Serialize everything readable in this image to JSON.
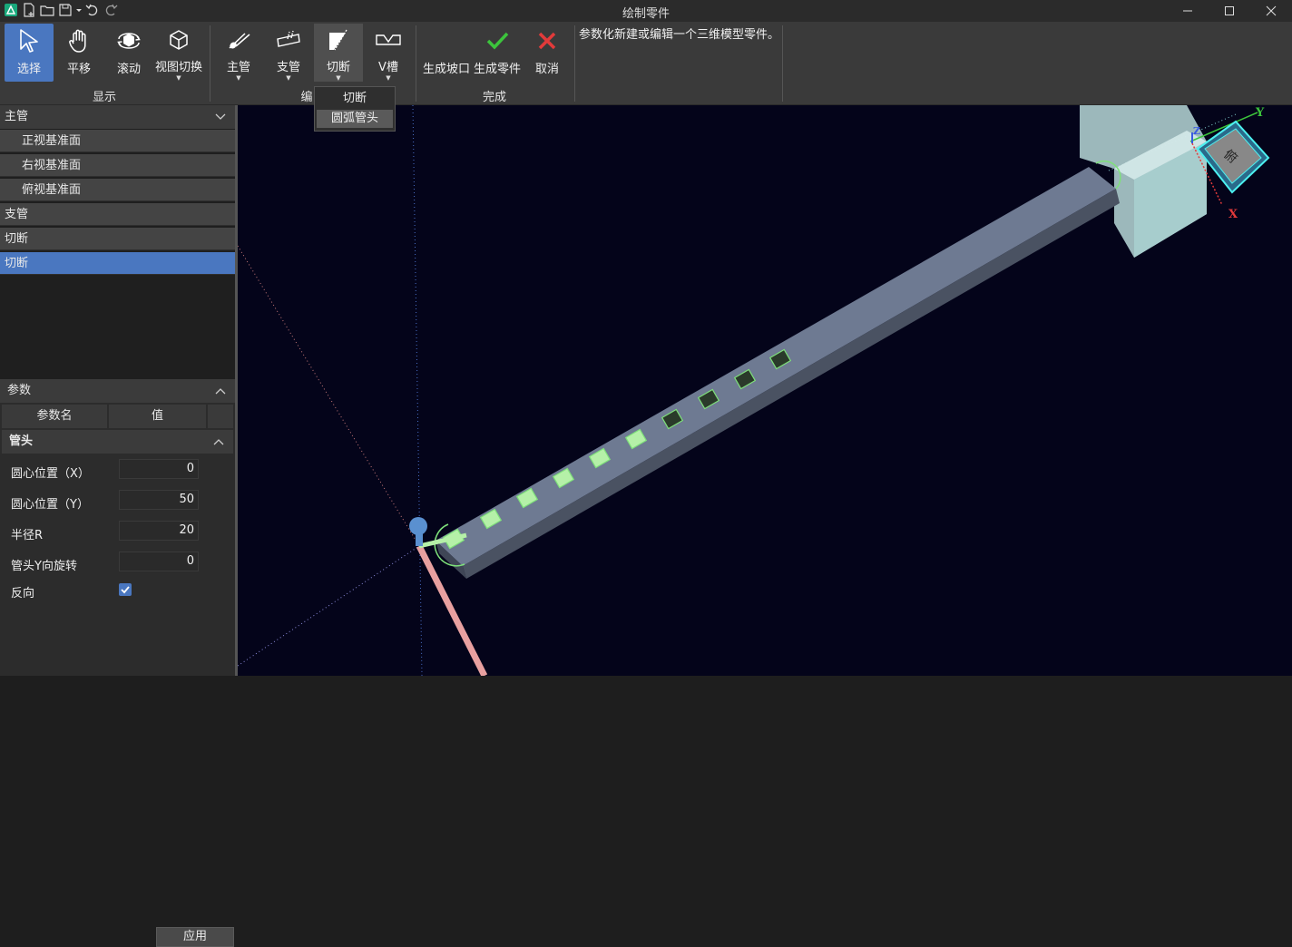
{
  "window": {
    "title": "绘制零件"
  },
  "ribbon": {
    "buttons": {
      "select": "选择",
      "pan": "平移",
      "rotate": "滚动",
      "view_switch": "视图切换",
      "main_pipe": "主管",
      "branch_pipe": "支管",
      "cut": "切断",
      "v_groove": "V槽",
      "gen_bevel": "生成坡口",
      "gen_part": "生成零件",
      "cancel": "取消"
    },
    "groups": {
      "display": "显示",
      "edit": "编",
      "finish": "完成"
    },
    "hint": "参数化新建或编辑一个三维模型零件。"
  },
  "dropdown": {
    "items": [
      "切断",
      "圆弧管头"
    ],
    "selected": "圆弧管头"
  },
  "tree": {
    "main_pipe": "主管",
    "planes": [
      "正视基准面",
      "右视基准面",
      "俯视基准面"
    ],
    "branch_pipe": "支管",
    "cut1": "切断",
    "cut2": "切断"
  },
  "params": {
    "header": "参数",
    "col_name": "参数名",
    "col_value": "值",
    "section": "管头",
    "rows": [
      {
        "label": "圆心位置（X）",
        "value": "0"
      },
      {
        "label": "圆心位置（Y）",
        "value": "50"
      },
      {
        "label": "半径R",
        "value": "20"
      },
      {
        "label": "管头Y向旋转",
        "value": "0"
      }
    ],
    "reverse_label": "反向",
    "reverse_checked": true,
    "apply": "应用"
  },
  "viewcube": {
    "face_label": "俯",
    "axis_x": "X",
    "axis_y": "Y",
    "axis_z": "Z"
  },
  "colors": {
    "accent": "#4a77c0",
    "viewport_bg": "#04041a",
    "pipe": "#6e7a92",
    "slot_green": "#7ee07a"
  }
}
